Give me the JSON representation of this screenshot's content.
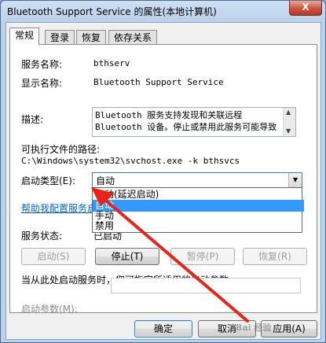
{
  "window": {
    "title": "Bluetooth Support Service 的属性(本地计算机)",
    "close_glyph": "X"
  },
  "tabs": [
    "常规",
    "登录",
    "恢复",
    "依存关系"
  ],
  "general": {
    "service_name_label": "服务名称:",
    "service_name": "bthserv",
    "display_name_label": "显示名称:",
    "display_name": "Bluetooth Support Service",
    "description_label": "描述:",
    "description": "Bluetooth 服务支持发现和关联远程\nBluetooth 设备。停止或禁用此服务可能导致",
    "path_label": "可执行文件的路径:",
    "path": "C:\\Windows\\system32\\svchost.exe -k bthsvcs",
    "startup_type_label": "启动类型(E):",
    "startup_type_value": "自动",
    "startup_options": [
      "自动(延迟启动)",
      "自动",
      "手动",
      "禁用"
    ],
    "startup_selected_index": 1,
    "help_link": "帮助我配置服务启动",
    "status_label": "服务状态:",
    "status_value": "已启动",
    "buttons": {
      "start": "启动(S)",
      "stop": "停止(T)",
      "pause": "暂停(P)",
      "resume": "恢复(R)"
    },
    "hint": "当从此处启动服务时，您可指定所适用的启动参数。",
    "start_params_label": "启动参数(M):",
    "start_params_value": ""
  },
  "footer": {
    "ok": "确定",
    "cancel": "取消",
    "apply": "应用(A)"
  },
  "watermark": "Bai 经验",
  "colors": {
    "arrow": "#e8231a",
    "selection": "#3399ff",
    "link": "#0066cc"
  }
}
